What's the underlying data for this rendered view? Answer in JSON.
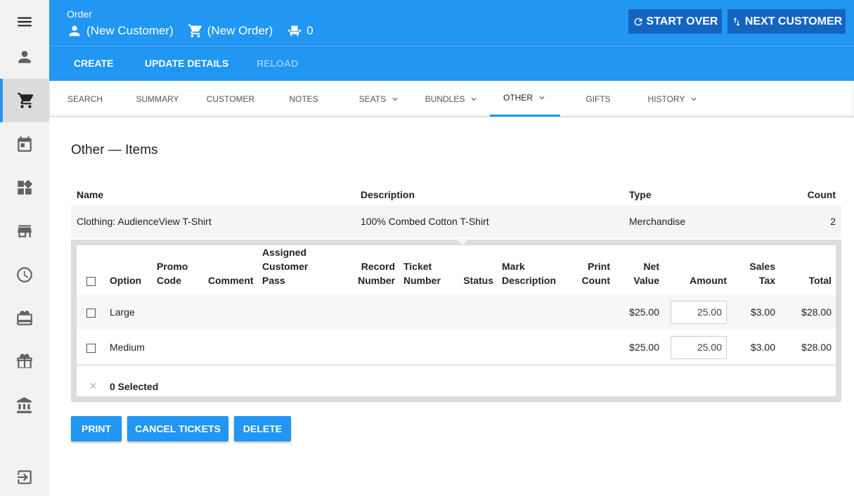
{
  "header": {
    "title": "Order",
    "customer": "(New Customer)",
    "order": "(New Order)",
    "seats": "0",
    "start_over": "START OVER",
    "next_customer": "NEXT CUSTOMER"
  },
  "actions": {
    "create": "CREATE",
    "update": "UPDATE DETAILS",
    "reload": "RELOAD"
  },
  "tabs": [
    "SEARCH",
    "SUMMARY",
    "CUSTOMER",
    "NOTES",
    "SEATS",
    "BUNDLES",
    "OTHER",
    "GIFTS",
    "HISTORY"
  ],
  "active_tab": "OTHER",
  "sidebar": [
    "menu-icon",
    "person-icon",
    "cart-icon",
    "calendar-icon",
    "widgets-icon",
    "store-icon",
    "clock-icon",
    "ticket-icon",
    "gift-icon",
    "bank-icon",
    "exit-icon"
  ],
  "section_title": "Other — Items",
  "items": {
    "headers": [
      "Name",
      "Description",
      "Type",
      "Count"
    ],
    "row": [
      "Clothing: AudienceView T-Shirt",
      "100% Combed Cotton T-Shirt",
      "Merchandise",
      "2"
    ]
  },
  "detail": {
    "headers": [
      "Option",
      "Promo Code",
      "Comment",
      "Assigned Customer Pass",
      "Record Number",
      "Ticket Number",
      "Status",
      "Mark Description",
      "Print Count",
      "Net Value",
      "Amount",
      "Sales Tax",
      "Total"
    ],
    "rows": [
      {
        "option": "Large",
        "net": "$25.00",
        "amount": "25.00",
        "tax": "$3.00",
        "total": "$28.00"
      },
      {
        "option": "Medium",
        "net": "$25.00",
        "amount": "25.00",
        "tax": "$3.00",
        "total": "$28.00"
      }
    ],
    "selected": "0 Selected"
  },
  "buttons": {
    "print": "PRINT",
    "cancel": "CANCEL TICKETS",
    "delete": "DELETE"
  },
  "colors": {
    "primary": "#2196f3",
    "dark": "#1565c0"
  }
}
